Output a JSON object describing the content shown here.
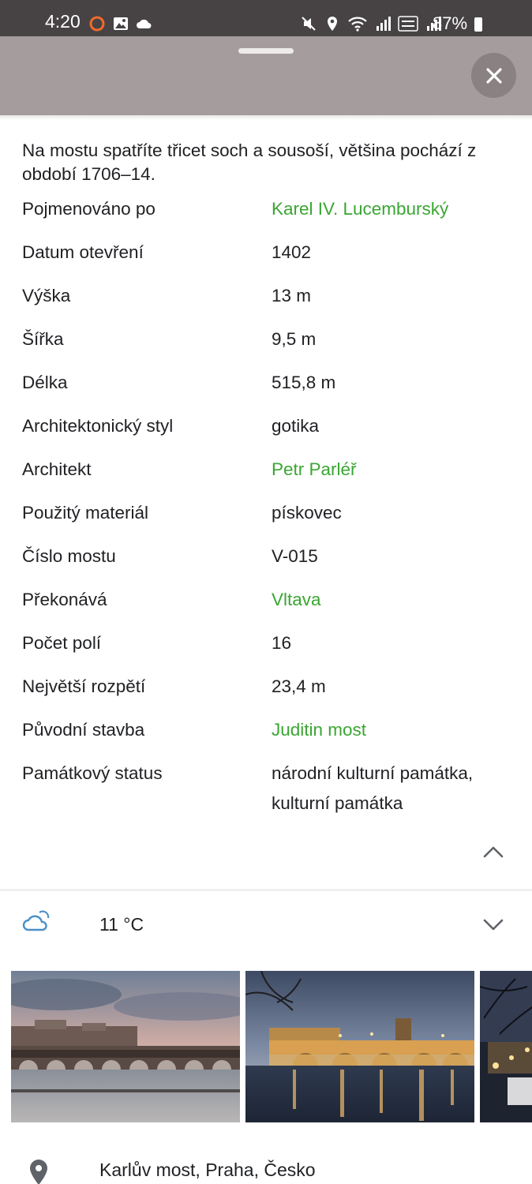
{
  "status_bar": {
    "time": "4:20",
    "battery": "87%",
    "icons": [
      "recording-ring-icon",
      "gallery-icon",
      "cloud-icon",
      "mute-icon",
      "location-icon",
      "wifi-icon",
      "signal-icon",
      "volte-icon",
      "signal-icon",
      "battery-icon"
    ]
  },
  "sheet": {
    "close_icon": "close-icon",
    "description": "Na mostu spatříte třicet soch a sousoší, většina pochází z období 1706–14."
  },
  "attributes": [
    {
      "label": "Pojmenováno po",
      "value": "Karel IV. Lucemburský",
      "link": true
    },
    {
      "label": "Datum otevření",
      "value": "1402",
      "link": false
    },
    {
      "label": "Výška",
      "value": "13 m",
      "link": false
    },
    {
      "label": "Šířka",
      "value": "9,5 m",
      "link": false
    },
    {
      "label": "Délka",
      "value": "515,8 m",
      "link": false
    },
    {
      "label": "Architektonický styl",
      "value": "gotika",
      "link": false
    },
    {
      "label": "Architekt",
      "value": "Petr Parléř",
      "link": true
    },
    {
      "label": "Použitý materiál",
      "value": "pískovec",
      "link": false
    },
    {
      "label": "Číslo mostu",
      "value": "V-015",
      "link": false
    },
    {
      "label": "Překonává",
      "value": "Vltava",
      "link": true
    },
    {
      "label": "Počet polí",
      "value": "16",
      "link": false
    },
    {
      "label": "Největší rozpětí",
      "value": "23,4 m",
      "link": false
    },
    {
      "label": "Původní stavba",
      "value": "Juditin most",
      "link": true
    },
    {
      "label": "Památkový status",
      "value": "národní kulturní památka, kulturní památka",
      "link": false
    }
  ],
  "weather": {
    "icon": "partly-cloudy-icon",
    "temperature": "11 °C"
  },
  "address": {
    "icon": "location-pin-icon",
    "text": "Karlův most, Praha, Česko"
  },
  "colors": {
    "link": "#3aa632",
    "header_bg": "#a59d9d",
    "status_bg": "#474344",
    "weather_icon": "#4a90c8"
  }
}
